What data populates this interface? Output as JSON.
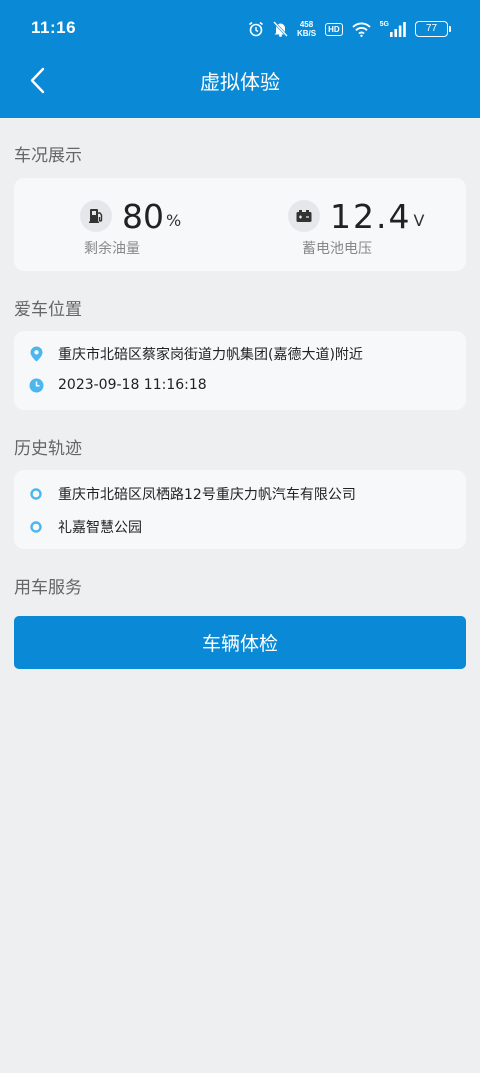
{
  "status_bar": {
    "time": "11:16",
    "speed_value": "458",
    "speed_unit": "KB/S",
    "hd": "HD",
    "network": "5G",
    "battery": "77"
  },
  "nav": {
    "title": "虚拟体验"
  },
  "vehicle_status": {
    "section_title": "车况展示",
    "fuel": {
      "value": "80",
      "unit": "%",
      "label": "剩余油量"
    },
    "battery": {
      "value": "12.4",
      "unit": "V",
      "label": "蓄电池电压"
    }
  },
  "location": {
    "section_title": "爱车位置",
    "address": "重庆市北碚区蔡家岗街道力帆集团(嘉德大道)附近",
    "time": "2023-09-18 11:16:18"
  },
  "history": {
    "section_title": "历史轨迹",
    "items": [
      {
        "label": "重庆市北碚区凤栖路12号重庆力帆汽车有限公司"
      },
      {
        "label": "礼嘉智慧公园"
      }
    ]
  },
  "services": {
    "section_title": "用车服务",
    "check_button": "车辆体检"
  },
  "colors": {
    "primary": "#0a8ad6",
    "accent_light": "#4db6ee",
    "background": "#eeeff1",
    "card": "#f7f8f9"
  }
}
